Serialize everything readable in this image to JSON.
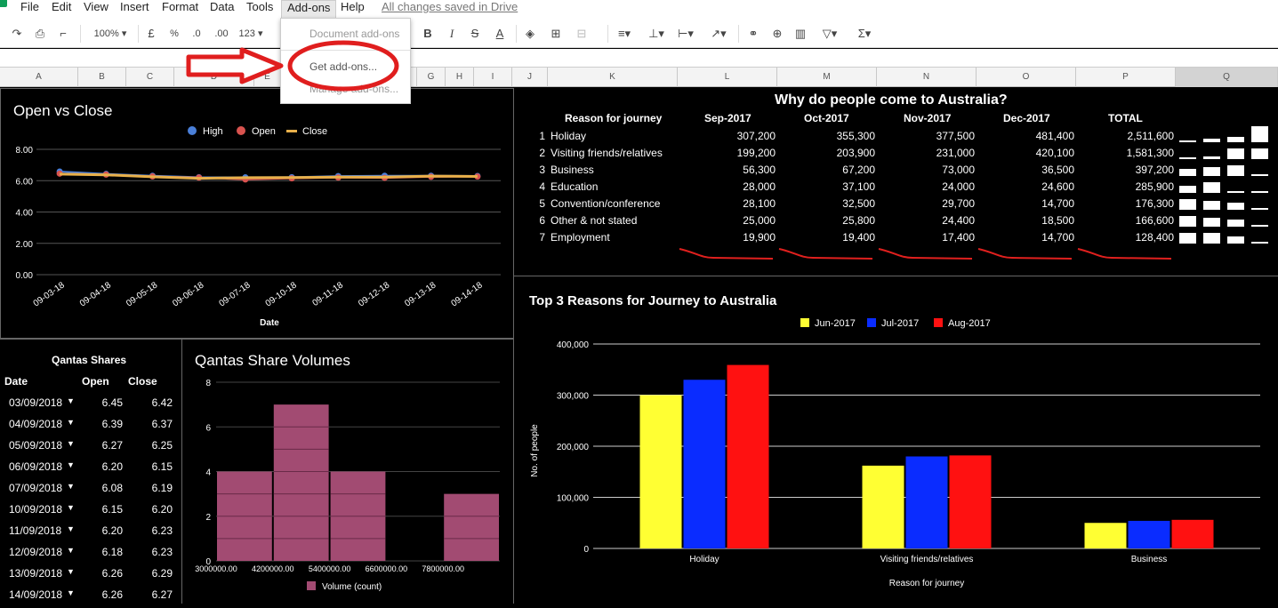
{
  "menu": {
    "items": [
      "File",
      "Edit",
      "View",
      "Insert",
      "Format",
      "Data",
      "Tools",
      "Add-ons",
      "Help"
    ],
    "saved": "All changes saved in Drive"
  },
  "toolbar": {
    "zoom": "100%",
    "currency": "£",
    "percent": "%",
    "dec_less": ".0",
    "dec_more": ".00",
    "format_more": "123"
  },
  "addons_menu": {
    "items": [
      "Document add-ons",
      "Get add-ons...",
      "Manage add-ons..."
    ]
  },
  "columns": [
    "A",
    "B",
    "C",
    "D",
    "E",
    "F",
    "G",
    "H",
    "I",
    "J",
    "K",
    "L",
    "M",
    "N",
    "O",
    "P",
    "Q"
  ],
  "chart_open_close": {
    "title": "Open vs Close",
    "legend": [
      "High",
      "Open",
      "Close"
    ],
    "colors": [
      "#4a7fd8",
      "#d9534f",
      "#e8b04a"
    ],
    "xlabel": "Date",
    "yticks": [
      "8.00",
      "6.00",
      "4.00",
      "2.00",
      "0.00"
    ],
    "chart_data": {
      "type": "line",
      "x": [
        "09-03-18",
        "09-04-18",
        "09-05-18",
        "09-06-18",
        "09-07-18",
        "09-10-18",
        "09-11-18",
        "09-12-18",
        "09-13-18",
        "09-14-18"
      ],
      "series": [
        {
          "name": "High",
          "values": [
            6.58,
            6.43,
            6.31,
            6.22,
            6.21,
            6.22,
            6.29,
            6.31,
            6.31,
            6.3
          ]
        },
        {
          "name": "Open",
          "values": [
            6.45,
            6.39,
            6.27,
            6.2,
            6.08,
            6.15,
            6.2,
            6.18,
            6.25,
            6.26
          ]
        },
        {
          "name": "Close",
          "values": [
            6.42,
            6.37,
            6.25,
            6.15,
            6.19,
            6.2,
            6.23,
            6.23,
            6.29,
            6.27
          ]
        }
      ],
      "ylim": [
        0,
        8
      ],
      "xlabel": "Date"
    }
  },
  "qantas_table": {
    "title": "Qantas Shares",
    "headers": [
      "Date",
      "Open",
      "Close"
    ],
    "rows": [
      [
        "03/09/2018",
        "6.45",
        "6.42"
      ],
      [
        "04/09/2018",
        "6.39",
        "6.37"
      ],
      [
        "05/09/2018",
        "6.27",
        "6.25"
      ],
      [
        "06/09/2018",
        "6.20",
        "6.15"
      ],
      [
        "07/09/2018",
        "6.08",
        "6.19"
      ],
      [
        "10/09/2018",
        "6.15",
        "6.20"
      ],
      [
        "11/09/2018",
        "6.20",
        "6.23"
      ],
      [
        "12/09/2018",
        "6.18",
        "6.23"
      ],
      [
        "13/09/2018",
        "6.26",
        "6.29"
      ],
      [
        "14/09/2018",
        "6.26",
        "6.27"
      ]
    ]
  },
  "chart_volumes": {
    "title": "Qantas Share Volumes",
    "color": "#a24b72",
    "chart_data": {
      "type": "bar",
      "categories": [
        "3000000.00",
        "4200000.00",
        "5400000.00",
        "6600000.00",
        "7800000.00"
      ],
      "series": [
        {
          "name": "Volume (count)",
          "values": [
            4,
            7,
            4,
            0,
            3
          ]
        }
      ],
      "ylim": [
        0,
        8
      ],
      "yticks": [
        "8",
        "6",
        "4",
        "2",
        "0"
      ]
    }
  },
  "journey_table": {
    "title": "Why do people come to Australia?",
    "headers": [
      "Reason for journey",
      "Sep-2017",
      "Oct-2017",
      "Nov-2017",
      "Dec-2017",
      "TOTAL"
    ],
    "rows": [
      [
        "1",
        "Holiday",
        "307,200",
        "355,300",
        "377,500",
        "481,400",
        "2,511,600"
      ],
      [
        "2",
        "Visiting friends/relatives",
        "199,200",
        "203,900",
        "231,000",
        "420,100",
        "1,581,300"
      ],
      [
        "3",
        "Business",
        "56,300",
        "67,200",
        "73,000",
        "36,500",
        "397,200"
      ],
      [
        "4",
        "Education",
        "28,000",
        "37,100",
        "24,000",
        "24,600",
        "285,900"
      ],
      [
        "5",
        "Convention/conference",
        "28,100",
        "32,500",
        "29,700",
        "14,700",
        "176,300"
      ],
      [
        "6",
        "Other & not stated",
        "25,000",
        "25,800",
        "24,400",
        "18,500",
        "166,600"
      ],
      [
        "7",
        "Employment",
        "19,900",
        "19,400",
        "17,400",
        "14,700",
        "128,400"
      ]
    ],
    "sparkline_color": "#e0201e"
  },
  "chart_top3": {
    "title": "Top 3 Reasons for Journey to Australia",
    "xlabel": "Reason for journey",
    "ylabel": "No. of people",
    "yticks": [
      "400,000",
      "300,000",
      "200,000",
      "100,000",
      "0"
    ],
    "chart_data": {
      "type": "bar",
      "categories": [
        "Holiday",
        "Visiting friends/relatives",
        "Business"
      ],
      "series": [
        {
          "name": "Jun-2017",
          "color": "#ffff33",
          "values": [
            300000,
            162000,
            50000
          ]
        },
        {
          "name": "Jul-2017",
          "color": "#0a2cff",
          "values": [
            330000,
            180000,
            54000
          ]
        },
        {
          "name": "Aug-2017",
          "color": "#ff1111",
          "values": [
            359000,
            182000,
            56000
          ]
        }
      ],
      "ylim": [
        0,
        400000
      ],
      "xlabel": "Reason for journey",
      "ylabel": "No. of people"
    }
  }
}
